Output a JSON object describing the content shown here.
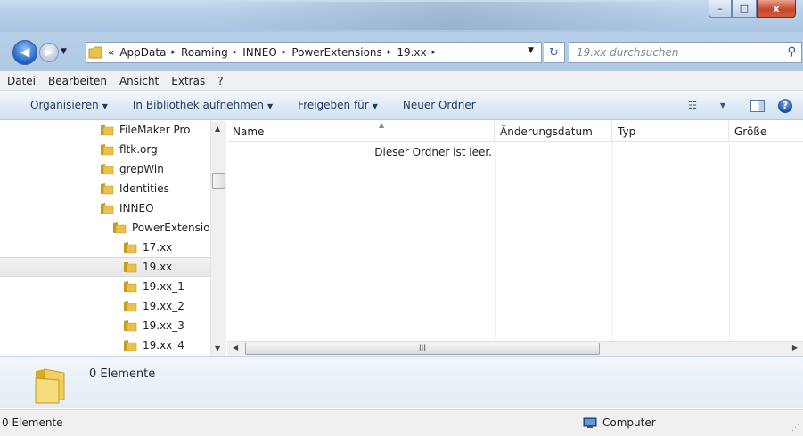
{
  "window": {
    "minimize": "–",
    "maximize": "□",
    "close": "x"
  },
  "nav": {
    "back_glyph": "◀",
    "forward_glyph": "▶",
    "history_glyph": "▼",
    "breadcrumb_overflow": "«",
    "breadcrumbs": [
      "AppData",
      "Roaming",
      "INNEO",
      "PowerExtensions",
      "19.xx"
    ],
    "separator": "▸",
    "address_dropdown": "▼",
    "refresh_glyph": "↻",
    "search_placeholder": "19.xx durchsuchen",
    "search_icon": "⚲"
  },
  "menu": [
    "Datei",
    "Bearbeiten",
    "Ansicht",
    "Extras",
    "?"
  ],
  "toolbar": {
    "organize": "Organisieren",
    "library": "In Bibliothek aufnehmen",
    "share": "Freigeben für",
    "new_folder": "Neuer Ordner",
    "dropdown_arrow": "▼",
    "view_glyph": "☷",
    "help_glyph": "?"
  },
  "tree": {
    "items": [
      {
        "label": "FileMaker Pro",
        "indent": 1,
        "selected": false
      },
      {
        "label": "fltk.org",
        "indent": 1,
        "selected": false
      },
      {
        "label": "grepWin",
        "indent": 1,
        "selected": false
      },
      {
        "label": "Identities",
        "indent": 1,
        "selected": false
      },
      {
        "label": "INNEO",
        "indent": 1,
        "selected": false
      },
      {
        "label": "PowerExtensior",
        "indent": 2,
        "selected": false
      },
      {
        "label": "17.xx",
        "indent": 3,
        "selected": false
      },
      {
        "label": "19.xx",
        "indent": 3,
        "selected": true
      },
      {
        "label": "19.xx_1",
        "indent": 3,
        "selected": false
      },
      {
        "label": "19.xx_2",
        "indent": 3,
        "selected": false
      },
      {
        "label": "19.xx_3",
        "indent": 3,
        "selected": false
      },
      {
        "label": "19.xx_4",
        "indent": 3,
        "selected": false
      }
    ],
    "scroll_up": "▲",
    "scroll_down": "▼"
  },
  "columns": {
    "name": "Name",
    "date": "Änderungsdatum",
    "type": "Typ",
    "size": "Größe",
    "sort_glyph": "▲"
  },
  "content": {
    "empty_message": "Dieser Ordner ist leer.",
    "scroll_left": "◀",
    "scroll_right": "▶",
    "thumb_grip": "III"
  },
  "details": {
    "count": "0 Elemente"
  },
  "status": {
    "items": "0 Elemente",
    "location": "Computer",
    "grip": "⋰"
  },
  "colors": {
    "folder": "#e8c24a",
    "folder_dark": "#c79a22",
    "accent": "#1f60c4"
  }
}
